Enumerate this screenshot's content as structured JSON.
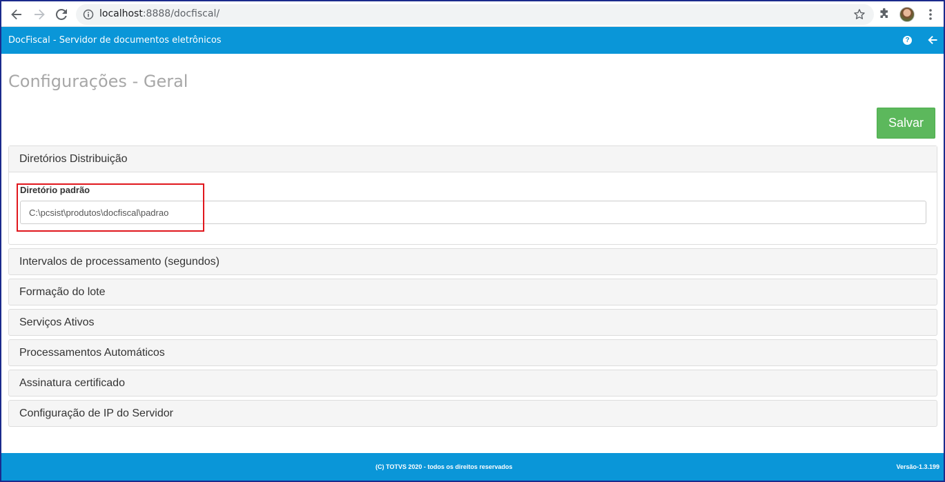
{
  "browser": {
    "url_host": "localhost",
    "url_rest": ":8888/docfiscal/"
  },
  "header": {
    "title": "DocFiscal - Servidor de documentos eletrônicos",
    "help_glyph": "?"
  },
  "page": {
    "title": "Configurações - Geral",
    "save_label": "Salvar"
  },
  "panels": [
    {
      "label": "Diretórios Distribuição",
      "expanded": true,
      "fields": [
        {
          "label": "Diretório padrão",
          "value": "C:\\pcsist\\produtos\\docfiscal\\padrao"
        }
      ]
    },
    {
      "label": "Intervalos de processamento (segundos)",
      "expanded": false
    },
    {
      "label": "Formação do lote",
      "expanded": false
    },
    {
      "label": "Serviços Ativos",
      "expanded": false
    },
    {
      "label": "Processamentos Automáticos",
      "expanded": false
    },
    {
      "label": "Assinatura certificado",
      "expanded": false
    },
    {
      "label": "Configuração de IP do Servidor",
      "expanded": false
    }
  ],
  "footer": {
    "copyright": "(C) TOTVS 2020 - todos os direitos reservados",
    "version": "Versão-1.3.199"
  },
  "colors": {
    "header_blue": "#0a96d8",
    "save_green": "#5cb85c",
    "highlight_red": "#e0161c"
  },
  "icons": [
    "back-arrow-icon",
    "forward-arrow-icon",
    "reload-icon",
    "info-icon",
    "star-icon",
    "puzzle-icon",
    "kebab-menu-icon",
    "help-icon",
    "back-icon"
  ]
}
